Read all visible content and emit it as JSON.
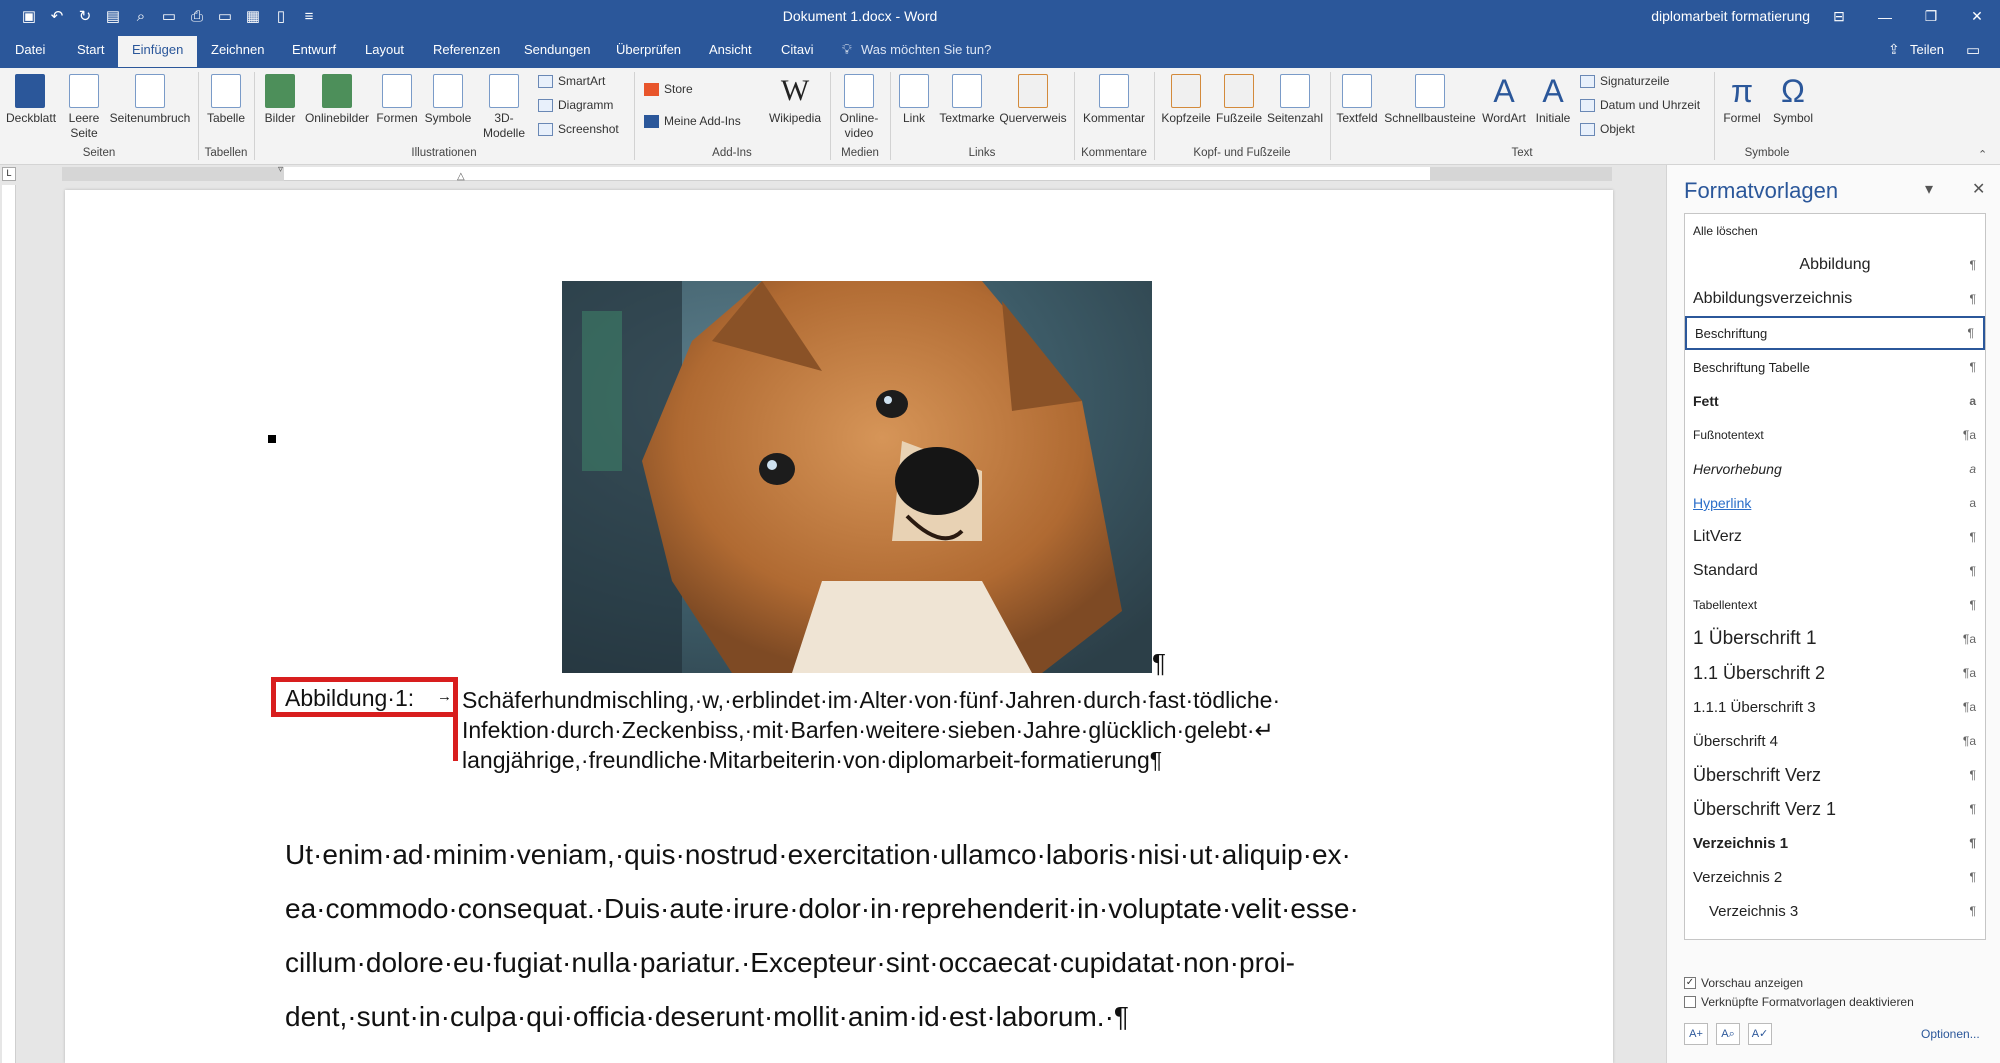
{
  "titlebar": {
    "doc_title": "Dokument 1.docx  -  Word",
    "search_title": "diplomarbeit formatierung"
  },
  "tabs": [
    {
      "label": "Datei"
    },
    {
      "label": "Start"
    },
    {
      "label": "Einfügen"
    },
    {
      "label": "Zeichnen"
    },
    {
      "label": "Entwurf"
    },
    {
      "label": "Layout"
    },
    {
      "label": "Referenzen"
    },
    {
      "label": "Sendungen"
    },
    {
      "label": "Überprüfen"
    },
    {
      "label": "Ansicht"
    },
    {
      "label": "Citavi"
    }
  ],
  "tell_me": "Was möchten Sie tun?",
  "share": "Teilen",
  "ribbon": {
    "buttons": [
      "Deckblatt",
      "Leere Seite",
      "Seitenumbruch",
      "Tabelle",
      "Bilder",
      "Onlinebilder",
      "Formen",
      "Symbole",
      "3D-Modelle",
      "Wikipedia",
      "Online-video",
      "Link",
      "Textmarke",
      "Querverweis",
      "Kommentar",
      "Kopfzeile",
      "Fußzeile",
      "Seitenzahl",
      "Textfeld",
      "Schnellbausteine",
      "WordArt",
      "Initiale",
      "Formel",
      "Symbol"
    ],
    "small": [
      "SmartArt",
      "Diagramm",
      "Screenshot",
      "Store",
      "Meine Add-Ins",
      "Signaturzeile",
      "Datum und Uhrzeit",
      "Objekt"
    ],
    "groups": [
      "Seiten",
      "Tabellen",
      "Illustrationen",
      "Add-Ins",
      "Medien",
      "Links",
      "Kommentare",
      "Kopf- und Fußzeile",
      "Text",
      "Symbole"
    ]
  },
  "document": {
    "caption_label": "Abbildung·1:",
    "caption_lines": [
      "Schäferhundmischling,·w,·erblindet·im·Alter·von·fünf·Jahren·durch·fast·tödliche·",
      "Infektion·durch·Zeckenbiss,·mit·Barfen·weitere·sieben·Jahre·glücklich·gelebt·↵",
      "langjährige,·freundliche·Mitarbeiterin·von·diplomarbeit-formatierung¶"
    ],
    "body_lines": [
      "Ut·enim·ad·minim·veniam,·quis·nostrud·exercitation·ullamco·laboris·nisi·ut·aliquip·ex·",
      "ea·commodo·consequat.·Duis·aute·irure·dolor·in·reprehenderit·in·voluptate·velit·esse·",
      "cillum·dolore·eu·fugiat·nulla·pariatur.·Excepteur·sint·occaecat·cupidatat·non·proi-",
      "dent,·sunt·in·culpa·qui·officia·deserunt·mollit·anim·id·est·laborum.·¶"
    ]
  },
  "styles_pane": {
    "title": "Formatvorlagen",
    "clear_all": "Alle löschen",
    "items": [
      {
        "label": "Abbildung",
        "mark": "¶"
      },
      {
        "label": "Abbildungsverzeichnis",
        "mark": "¶"
      },
      {
        "label": "Beschriftung",
        "mark": "¶"
      },
      {
        "label": "Beschriftung Tabelle",
        "mark": "¶"
      },
      {
        "label": "Fett",
        "mark": "a"
      },
      {
        "label": "Fußnotentext",
        "mark": "¶a"
      },
      {
        "label": "Hervorhebung",
        "mark": "a"
      },
      {
        "label": "Hyperlink",
        "mark": "a"
      },
      {
        "label": "LitVerz",
        "mark": "¶"
      },
      {
        "label": "Standard",
        "mark": "¶"
      },
      {
        "label": "Tabellentext",
        "mark": "¶"
      },
      {
        "label": "1  Überschrift 1",
        "mark": "¶a"
      },
      {
        "label": "1.1  Überschrift 2",
        "mark": "¶a"
      },
      {
        "label": "1.1.1  Überschrift 3",
        "mark": "¶a"
      },
      {
        "label": "Überschrift 4",
        "mark": "¶a"
      },
      {
        "label": "Überschrift Verz",
        "mark": "¶"
      },
      {
        "label": "Überschrift Verz 1",
        "mark": "¶"
      },
      {
        "label": "Verzeichnis 1",
        "mark": "¶"
      },
      {
        "label": "Verzeichnis 2",
        "mark": "¶"
      },
      {
        "label": "Verzeichnis 3",
        "mark": "¶"
      }
    ],
    "preview_label": "Vorschau anzeigen",
    "linked_label": "Verknüpfte Formatvorlagen deaktivieren",
    "options": "Optionen..."
  },
  "colors": {
    "brand": "#2b579a",
    "highlight": "#d81e1e"
  }
}
